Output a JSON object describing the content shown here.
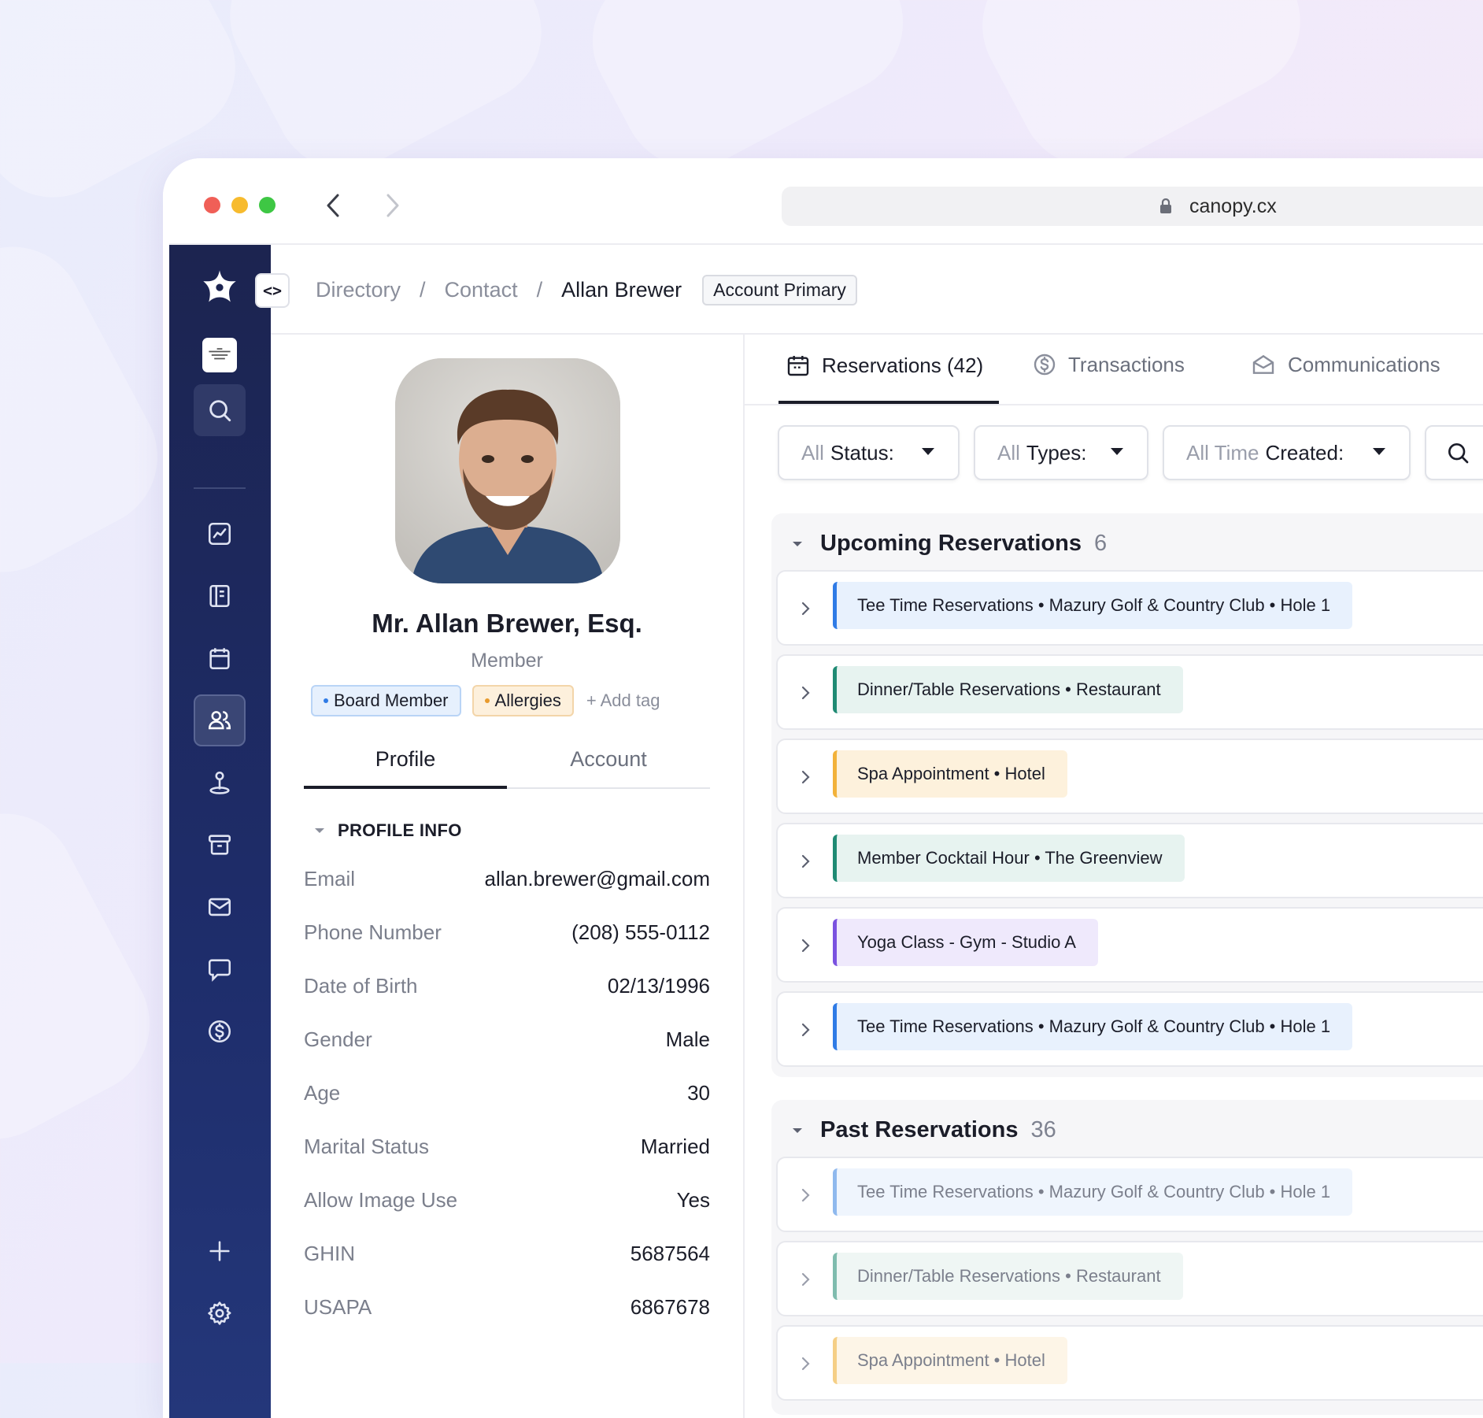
{
  "browser": {
    "url": "canopy.cx",
    "traffic_lights": [
      "#f05f57",
      "#f7bb2e",
      "#3ec744"
    ]
  },
  "breadcrumb": {
    "items": [
      "Directory",
      "Contact",
      "Allan Brewer"
    ],
    "separator": "/",
    "badge": "Account Primary"
  },
  "profile": {
    "name": "Mr. Allan Brewer, Esq.",
    "role": "Member",
    "tags": [
      {
        "label": "Board Member",
        "color": "#2f7be6"
      },
      {
        "label": "Allergies",
        "color": "#e89a2c"
      }
    ],
    "add_tag": "+ Add tag",
    "tabs": [
      "Profile",
      "Account"
    ],
    "active_tab": "Profile",
    "section_title": "PROFILE INFO",
    "fields": [
      {
        "label": "Email",
        "value": "allan.brewer@gmail.com"
      },
      {
        "label": "Phone Number",
        "value": "(208) 555-0112"
      },
      {
        "label": "Date of Birth",
        "value": "02/13/1996"
      },
      {
        "label": "Gender",
        "value": "Male"
      },
      {
        "label": "Age",
        "value": "30"
      },
      {
        "label": "Marital Status",
        "value": "Married"
      },
      {
        "label": "Allow Image Use",
        "value": "Yes"
      },
      {
        "label": "GHIN",
        "value": "5687564"
      },
      {
        "label": "USAPA",
        "value": "6867678"
      }
    ]
  },
  "tabs": [
    {
      "label": "Reservations (42)",
      "icon": "calendar-icon"
    },
    {
      "label": "Transactions",
      "icon": "dollar-circle-icon"
    },
    {
      "label": "Communications",
      "icon": "envelope-open-icon"
    }
  ],
  "filters": [
    {
      "muted": "All",
      "label": "Status:"
    },
    {
      "muted": "All",
      "label": "Types:"
    },
    {
      "muted": "All Time",
      "label": "Created:"
    }
  ],
  "upcoming": {
    "title": "Upcoming Reservations",
    "count": "6",
    "items": [
      {
        "text": "Tee Time Reservations  •  Mazury Golf & Country Club  •  Hole 1",
        "accent": "#2f7be6",
        "bg": "#e8f1fd"
      },
      {
        "text": "Dinner/Table Reservations  •  Restaurant",
        "accent": "#1f8a73",
        "bg": "#e7f3f0"
      },
      {
        "text": "Spa Appointment •  Hotel",
        "accent": "#f2b23a",
        "bg": "#fdf1dc"
      },
      {
        "text": "Member Cocktail Hour  •  The Greenview",
        "accent": "#1f8a73",
        "bg": "#e7f3f0"
      },
      {
        "text": "Yoga Class - Gym - Studio A",
        "accent": "#7a52e0",
        "bg": "#efe9fc"
      },
      {
        "text": "Tee Time Reservations  •  Mazury Golf & Country Club  •  Hole 1",
        "accent": "#2f7be6",
        "bg": "#e8f1fd"
      }
    ]
  },
  "past": {
    "title": "Past Reservations",
    "count": "36",
    "items": [
      {
        "text": "Tee Time Reservations  •  Mazury Golf & Country Club  •  Hole 1",
        "accent": "#8fb9ee",
        "bg": "#eff5fd"
      },
      {
        "text": "Dinner/Table Reservations  •  Restaurant",
        "accent": "#7fbcae",
        "bg": "#eff6f4"
      },
      {
        "text": "Spa Appointment  •  Hotel",
        "accent": "#f5cf86",
        "bg": "#fdf5e7"
      }
    ]
  }
}
